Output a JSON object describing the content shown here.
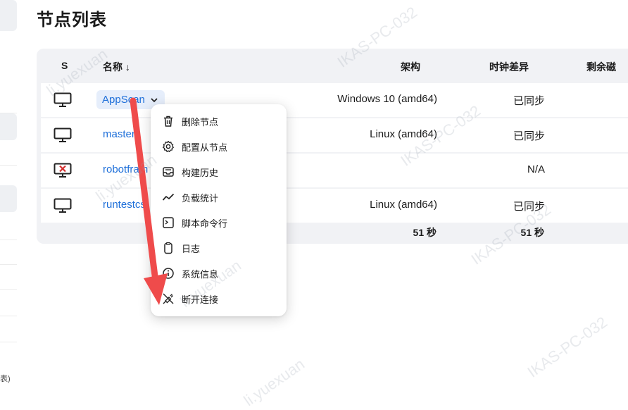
{
  "page": {
    "title": "节点列表"
  },
  "sidebar": {
    "footer_glyph": "表)"
  },
  "table": {
    "headers": {
      "status": "S",
      "name": "名称 ↓",
      "arch": "架构",
      "clock": "时钟差异",
      "remaining": "剩余磁"
    },
    "rows": [
      {
        "name": "AppScan",
        "arch": "Windows 10 (amd64)",
        "clock": "已同步",
        "status_icon": "computer-icon"
      },
      {
        "name": "master",
        "arch": "Linux (amd64)",
        "clock": "已同步",
        "status_icon": "computer-icon"
      },
      {
        "name": "robotfram",
        "arch": "",
        "clock": "N/A",
        "status_icon": "computer-offline-icon"
      },
      {
        "name": "runtestcs",
        "arch": "Linux (amd64)",
        "clock": "已同步",
        "status_icon": "computer-icon"
      }
    ],
    "footer": {
      "arch": "51 秒",
      "clock": "51 秒"
    }
  },
  "context_menu": {
    "items": [
      {
        "label": "删除节点",
        "icon": "trash-icon"
      },
      {
        "label": "配置从节点",
        "icon": "gear-icon"
      },
      {
        "label": "构建历史",
        "icon": "inbox-icon"
      },
      {
        "label": "负载统计",
        "icon": "trend-chart-icon"
      },
      {
        "label": "脚本命令行",
        "icon": "terminal-icon"
      },
      {
        "label": "日志",
        "icon": "clipboard-icon"
      },
      {
        "label": "系统信息",
        "icon": "info-icon"
      },
      {
        "label": "断开连接",
        "icon": "disconnect-icon"
      }
    ]
  },
  "colors": {
    "link": "#1e6fd9",
    "annotation_arrow": "#ef4b4b",
    "offline": "#d32f2f"
  },
  "watermarks": [
    "IKAS-PC-032",
    "li.yuexuan"
  ]
}
